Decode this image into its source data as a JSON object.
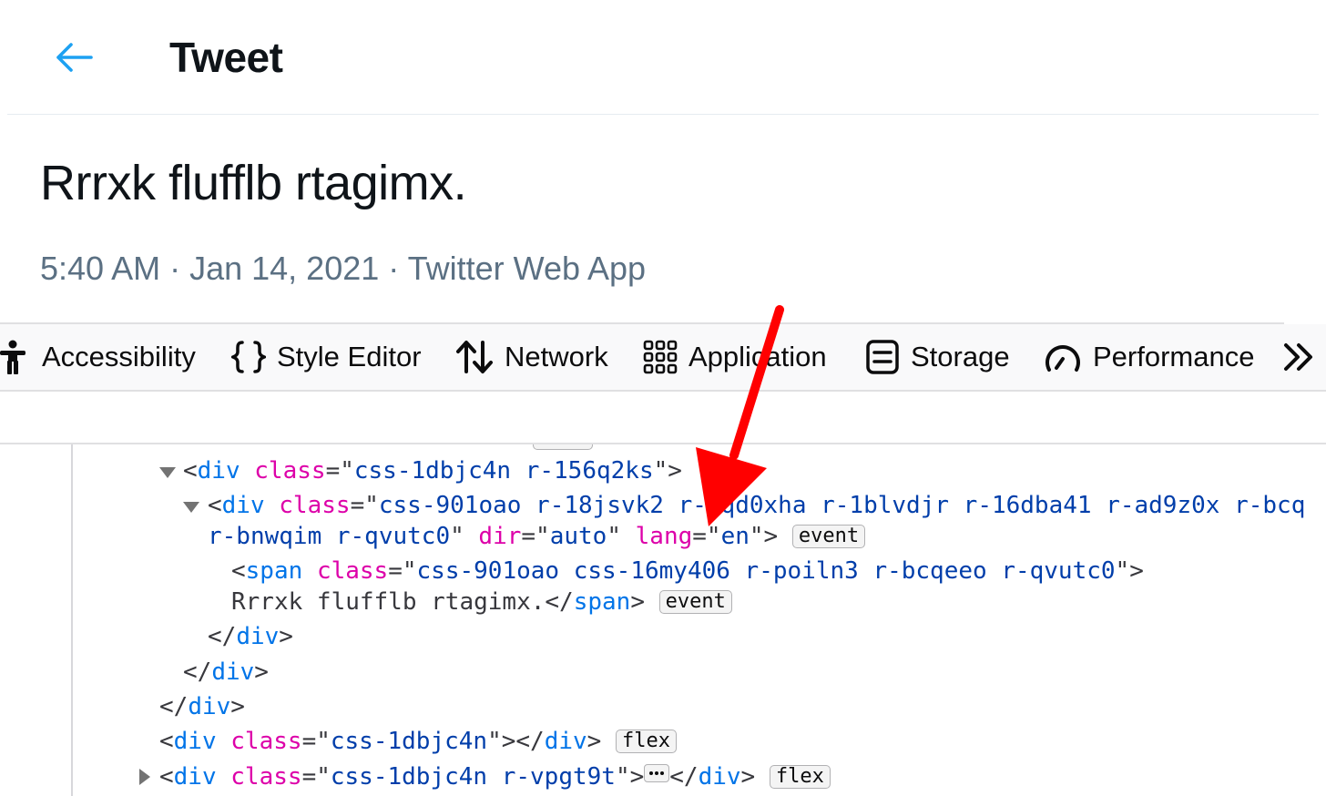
{
  "header": {
    "title": "Tweet"
  },
  "tweet": {
    "text": "Rrrxk flufflb rtagimx.",
    "time": "5:40 AM",
    "sep1": " · ",
    "date": "Jan 14, 2021",
    "sep2": " · ",
    "source": "Twitter Web App"
  },
  "devtools": {
    "tabs": [
      {
        "label": "Accessibility",
        "icon": "accessibility-icon"
      },
      {
        "label": "Style Editor",
        "icon": "braces-icon"
      },
      {
        "label": "Network",
        "icon": "network-arrows-icon"
      },
      {
        "label": "Application",
        "icon": "grid-icon"
      },
      {
        "label": "Storage",
        "icon": "storage-icon"
      },
      {
        "label": "Performance",
        "icon": "gauge-icon"
      }
    ],
    "more_icon": "chevrons-right-icon",
    "tree": {
      "l1": {
        "tag": "div",
        "attr": "class",
        "val": "css-1dbjc4n r-156q2ks"
      },
      "l2": {
        "tag": "div",
        "attr": "class",
        "val": "css-901oao r-18jsvk2 r-1qd0xha r-1blvdjr r-16dba41 r-ad9z0x r-bcq",
        "val_cont": "r-bnwqim r-qvutc0",
        "attr2": "dir",
        "val2": "auto",
        "attr3": "lang",
        "val3": "en",
        "badge": "event"
      },
      "l3": {
        "tag": "span",
        "attr": "class",
        "val": "css-901oao css-16my406 r-poiln3 r-bcqeeo r-qvutc0",
        "text": "Rrrxk flufflb rtagimx.",
        "badge": "event"
      },
      "l4": {
        "tag": "div"
      },
      "l5": {
        "tag": "div"
      },
      "l6": {
        "tag": "div"
      },
      "l7": {
        "tag": "div",
        "attr": "class",
        "val": "css-1dbjc4n",
        "badge": "flex"
      },
      "l8": {
        "tag": "div",
        "attr": "class",
        "val": "css-1dbjc4n r-vpgt9t",
        "badge": "flex"
      }
    }
  },
  "annotation": {
    "arrow_color": "#ff0000"
  },
  "colors": {
    "twitter_blue": "#1da1f2",
    "meta_gray": "#5b7083",
    "tag_blue": "#0074e8",
    "attr_pink": "#dd00a9",
    "value_navy": "#003eaa"
  }
}
